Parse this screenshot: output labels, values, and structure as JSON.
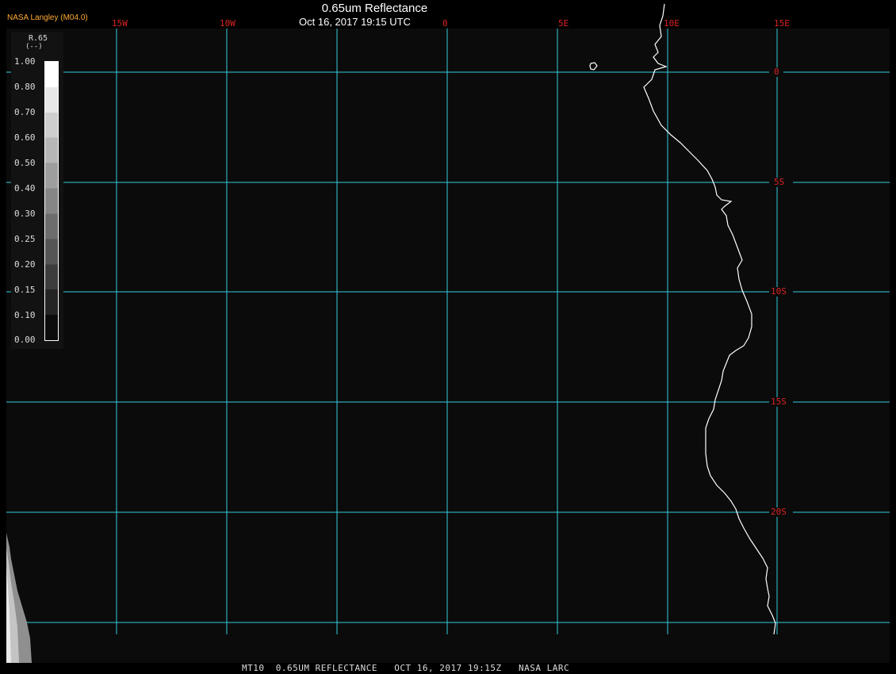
{
  "header": {
    "title": "0.65um Reflectance",
    "subtitle": "Oct 16, 2017 19:15 UTC",
    "agency": "NASA Langley (M04.0)"
  },
  "footer": {
    "caption": "MT10  0.65UM REFLECTANCE   OCT 16, 2017 19:15Z   NASA LARC"
  },
  "legend": {
    "variable": "R.65",
    "unit": "(--)",
    "ticks": [
      "1.00",
      "0.80",
      "0.70",
      "0.60",
      "0.50",
      "0.40",
      "0.30",
      "0.25",
      "0.20",
      "0.15",
      "0.10",
      "0.00"
    ]
  },
  "map": {
    "longitude_labels": [
      "15W",
      "10W",
      "0",
      "5E",
      "10E",
      "15E"
    ],
    "latitude_labels": [
      "0",
      "5S",
      "10S",
      "15S",
      "20S"
    ],
    "colors": {
      "grid": "#33ccdd",
      "labels": "#dd2222",
      "coast": "#ffffff",
      "background": "#0b0b0b"
    }
  }
}
